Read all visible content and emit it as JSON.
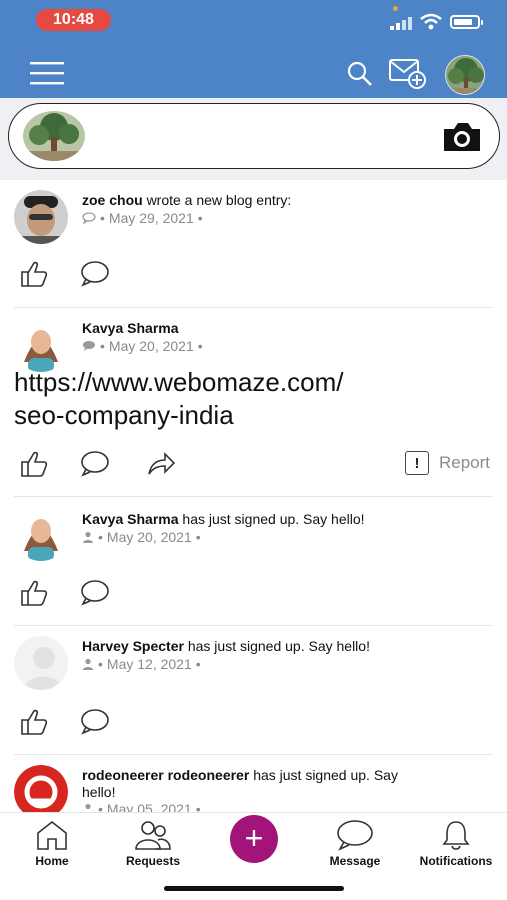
{
  "status_bar": {
    "time": "10:48"
  },
  "composer": {},
  "feed": [
    {
      "author": "zoe chou",
      "action": "wrote a new blog entry:",
      "date": "May 29, 2021",
      "meta_icon": "comment-outline-icon"
    },
    {
      "author": "Kavya Sharma",
      "action": "",
      "date": "May 20, 2021",
      "meta_icon": "comment-filled-icon",
      "body_line1": "https://www.webomaze.com/",
      "body_line2": "seo-company-india",
      "report_label": "Report"
    },
    {
      "author": "Kavya Sharma",
      "action": "has just signed up. Say hello!",
      "date": "May 20, 2021",
      "meta_icon": "user-icon"
    },
    {
      "author": "Harvey Specter",
      "action": "has just signed up. Say hello!",
      "date": "May 12, 2021",
      "meta_icon": "user-icon"
    },
    {
      "author": "rodeoneerer rodeoneerer",
      "action": "has just signed up. Say",
      "action2": "hello!",
      "date": "May 05, 2021",
      "meta_icon": "user-icon"
    }
  ],
  "meta_sep": "•",
  "bottom_nav": {
    "home": "Home",
    "requests": "Requests",
    "message": "Message",
    "notifications": "Notifications"
  },
  "colors": {
    "header": "#4c84c7",
    "plus": "#a3147a",
    "time_pill": "#e5493f"
  }
}
